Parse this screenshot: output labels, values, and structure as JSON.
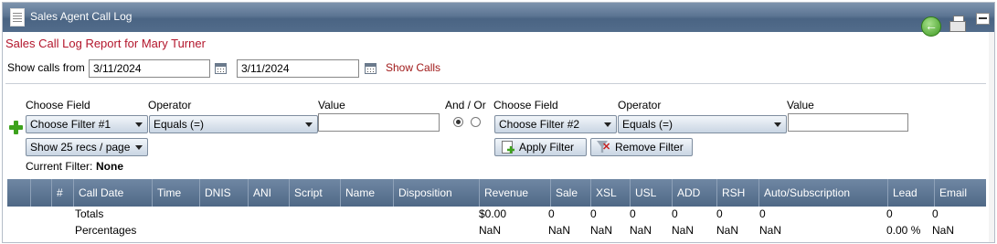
{
  "window": {
    "title": "Sales Agent Call Log"
  },
  "report": {
    "title": "Sales Call Log Report for Mary Turner"
  },
  "date_range": {
    "label": "Show calls from",
    "from": "3/11/2024",
    "to": "3/11/2024",
    "show_link": "Show Calls"
  },
  "filters": {
    "choose_field_label": "Choose Field",
    "operator_label": "Operator",
    "value_label": "Value",
    "and_or_label": "And / Or",
    "filter1": {
      "field": "Choose Filter #1",
      "operator": "Equals (=)",
      "value": ""
    },
    "filter2": {
      "field": "Choose Filter #2",
      "operator": "Equals (=)",
      "value": ""
    },
    "page_size": "Show 25 recs / page",
    "current_filter_label": "Current Filter:",
    "current_filter_value": "None",
    "apply_label": "Apply Filter",
    "remove_label": "Remove Filter",
    "and_or_selected": "and"
  },
  "grid": {
    "columns": [
      "",
      "",
      "#",
      "Call Date",
      "Time",
      "DNIS",
      "ANI",
      "Script",
      "Name",
      "Disposition",
      "Revenue",
      "Sale",
      "XSL",
      "USL",
      "ADD",
      "RSH",
      "Auto/Subscription",
      "Lead",
      "Email"
    ],
    "totals": {
      "label": "Totals",
      "revenue": "$0.00",
      "sale": "0",
      "xsl": "0",
      "usl": "0",
      "add": "0",
      "rsh": "0",
      "auto": "0",
      "lead": "0",
      "email": "0"
    },
    "percentages": {
      "label": "Percentages",
      "revenue": "NaN",
      "sale": "NaN",
      "xsl": "NaN",
      "usl": "NaN",
      "add": "NaN",
      "rsh": "NaN",
      "auto": "NaN",
      "lead": "0.00 %",
      "email": "NaN"
    }
  },
  "colors": {
    "title_red": "#b3162c",
    "link_red": "#a01a1a",
    "header_blue": "#5c7593",
    "add_green": "#3da21d"
  }
}
